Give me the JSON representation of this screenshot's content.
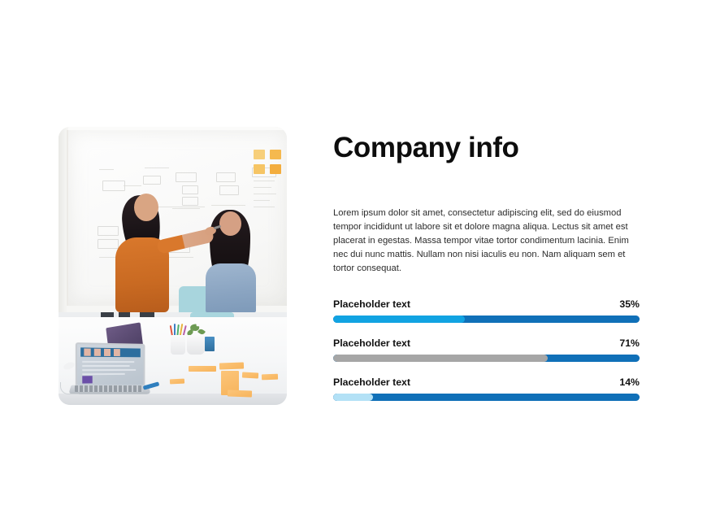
{
  "slide": {
    "background_color": "#ffffff"
  },
  "photo": {
    "alt": "Two women standing at a whiteboard covered in diagrams and orange sticky notes, with a white desk below holding an open laptop, a tablet, a pen cup, a small plant and orange sticky notes",
    "icon": "team-whiteboard-photo"
  },
  "heading": {
    "title": "Company info"
  },
  "body": {
    "paragraph": "Lorem ipsum dolor sit amet, consectetur adipiscing elit, sed do eiusmod tempor incididunt ut labore sit et dolore magna aliqua. Lectus sit amet est placerat in egestas. Massa tempor  vitae tortor condimentum lacinia. Enim nec dui nunc mattis. Nullam non nisi iaculis eu non. Nam aliquam sem et tortor consequat."
  },
  "chart_data": {
    "type": "bar",
    "title": "Company info",
    "orientation": "horizontal",
    "categories": [
      "Placeholder text",
      "Placeholder text",
      "Placeholder text"
    ],
    "values": [
      35,
      71,
      14
    ],
    "value_labels": [
      "35%",
      "71%",
      "14%"
    ],
    "xlabel": "",
    "ylabel": "",
    "xlim": [
      0,
      100
    ],
    "grid": false,
    "legend": false,
    "bars": [
      {
        "label": "Placeholder text",
        "value": 35,
        "value_label": "35%",
        "lead_fraction_pct": 43,
        "lead_color": "#11a3e2",
        "base_color": "#1070b8"
      },
      {
        "label": "Placeholder text",
        "value": 71,
        "value_label": "71%",
        "lead_fraction_pct": 70,
        "lead_color": "#a6a6a6",
        "base_color": "#1070b8"
      },
      {
        "label": "Placeholder text",
        "value": 14,
        "value_label": "14%",
        "lead_fraction_pct": 13,
        "lead_color": "#b3e1f6",
        "base_color": "#1070b8"
      }
    ]
  },
  "colors": {
    "accent_light_blue": "#11a3e2",
    "accent_dark_blue": "#1070b8",
    "accent_pale_blue": "#b3e1f6",
    "neutral_gray": "#a6a6a6",
    "text_dark": "#111111",
    "text_body": "#2b2b2b"
  }
}
